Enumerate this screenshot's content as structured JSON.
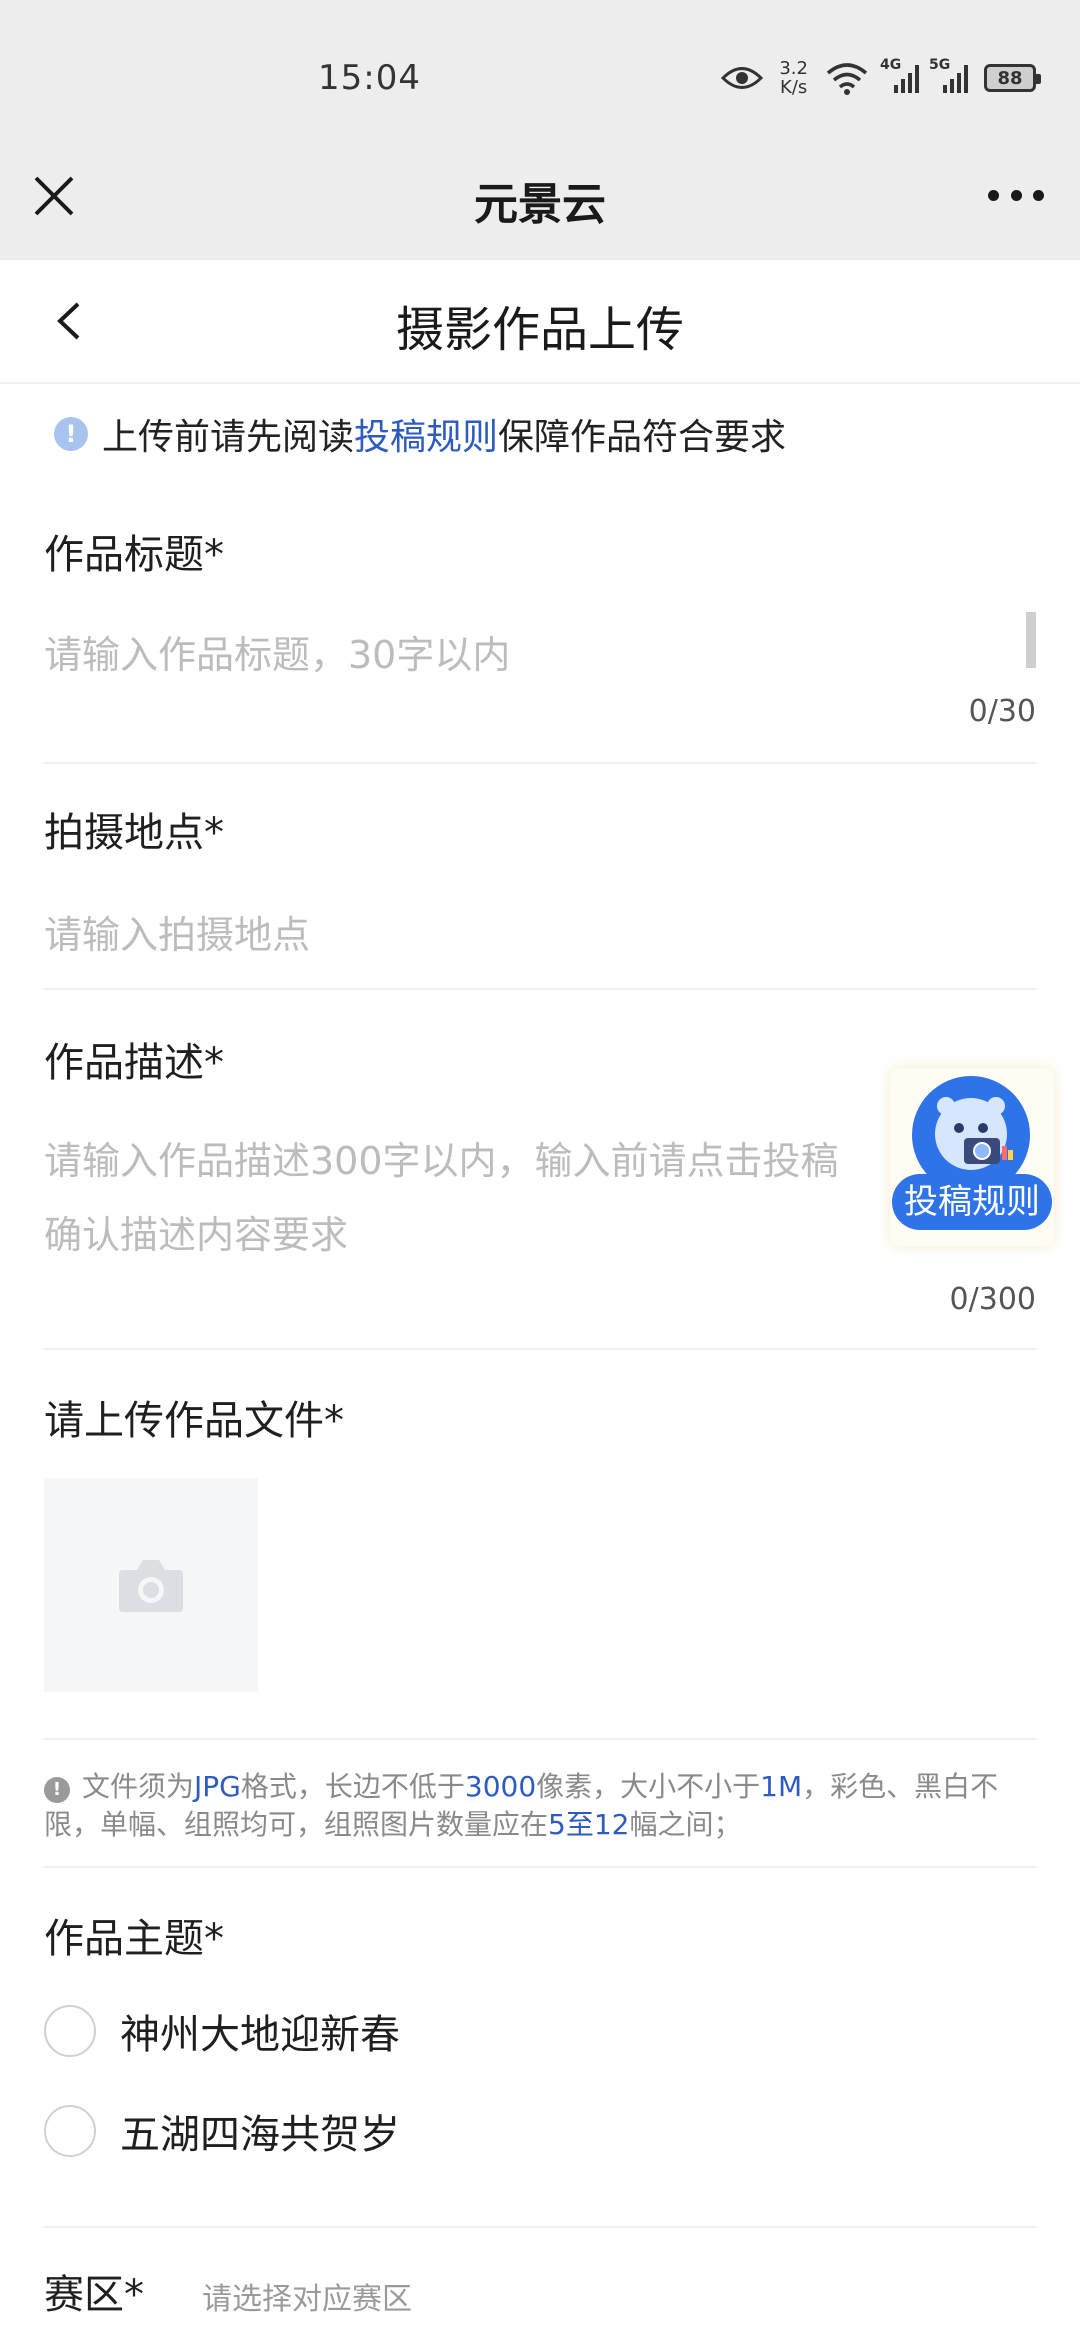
{
  "status_bar": {
    "time": "15:04",
    "speed_value": "3.2",
    "speed_unit": "K/s",
    "signal1_tag": "4G",
    "signal2_tag": "5G",
    "battery": "88"
  },
  "wechat_bar": {
    "title": "元景云"
  },
  "header": {
    "title": "摄影作品上传"
  },
  "notice": {
    "prefix": "上传前请先阅读",
    "link": "投稿规则",
    "suffix": "保障作品符合要求"
  },
  "form": {
    "title_field": {
      "label": "作品标题*",
      "placeholder": "请输入作品标题，30字以内",
      "counter": "0/30"
    },
    "location_field": {
      "label": "拍摄地点*",
      "placeholder": "请输入拍摄地点"
    },
    "description_field": {
      "label": "作品描述*",
      "placeholder_line1": "请输入作品描述300字以内，输入前请点击投稿",
      "placeholder_line2": "确认描述内容要求",
      "counter": "0/300"
    },
    "upload_field": {
      "label": "请上传作品文件*"
    },
    "file_hint": {
      "t1": "文件须为",
      "h1": "JPG",
      "t2": "格式，长边不低于",
      "h2": "3000",
      "t3": "像素，大小不小于",
      "h3": "1M",
      "t4": "，彩色、黑白不限，单幅、组照均可，组照图片数量应在",
      "h4": "5至12",
      "t5": "幅之间；"
    },
    "theme_field": {
      "label": "作品主题*",
      "options": [
        "神州大地迎新春",
        "五湖四海共贺岁"
      ]
    },
    "region_field": {
      "label": "赛区*",
      "placeholder": "请选择对应赛区"
    }
  },
  "float_badge": {
    "label": "投稿规则"
  },
  "colors": {
    "link": "#2d5bbf",
    "badge": "#2f73e8",
    "bar_bg": "#ededed"
  }
}
